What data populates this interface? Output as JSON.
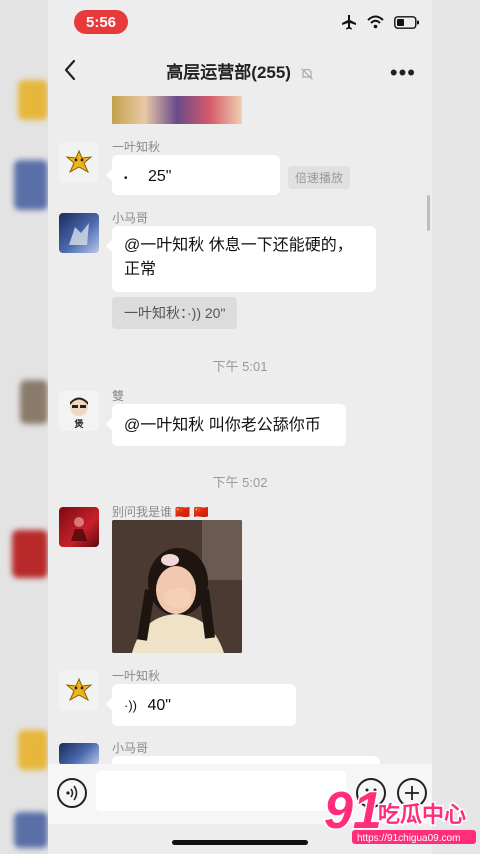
{
  "status_bar": {
    "time": "5:56"
  },
  "header": {
    "title": "高层运营部(255)"
  },
  "messages": [
    {
      "sender": "一叶知秋",
      "voice_duration": "25\"",
      "speed_tag": "倍速播放"
    },
    {
      "sender": "小马哥",
      "text_line1": "@一叶知秋 休息一下还能硬的，",
      "text_line2": "正常",
      "quote": "一叶知秋：·)) 20\""
    },
    {
      "sender": "雙",
      "avatar_text": "煲",
      "text": "@一叶知秋 叫你老公舔你币"
    },
    {
      "sender": "别问我是谁 🇨🇳 🇨🇳"
    },
    {
      "sender": "一叶知秋",
      "voice_duration": "40\""
    },
    {
      "sender": "小马哥"
    }
  ],
  "time_separators": [
    "下午 5:01",
    "下午 5:02"
  ],
  "watermark": {
    "brand": "91吃瓜中心",
    "url": "https://91chigua09.com"
  },
  "colors": {
    "time_pill": "#e8393b",
    "watermark_pink": "#ff2d7a"
  }
}
